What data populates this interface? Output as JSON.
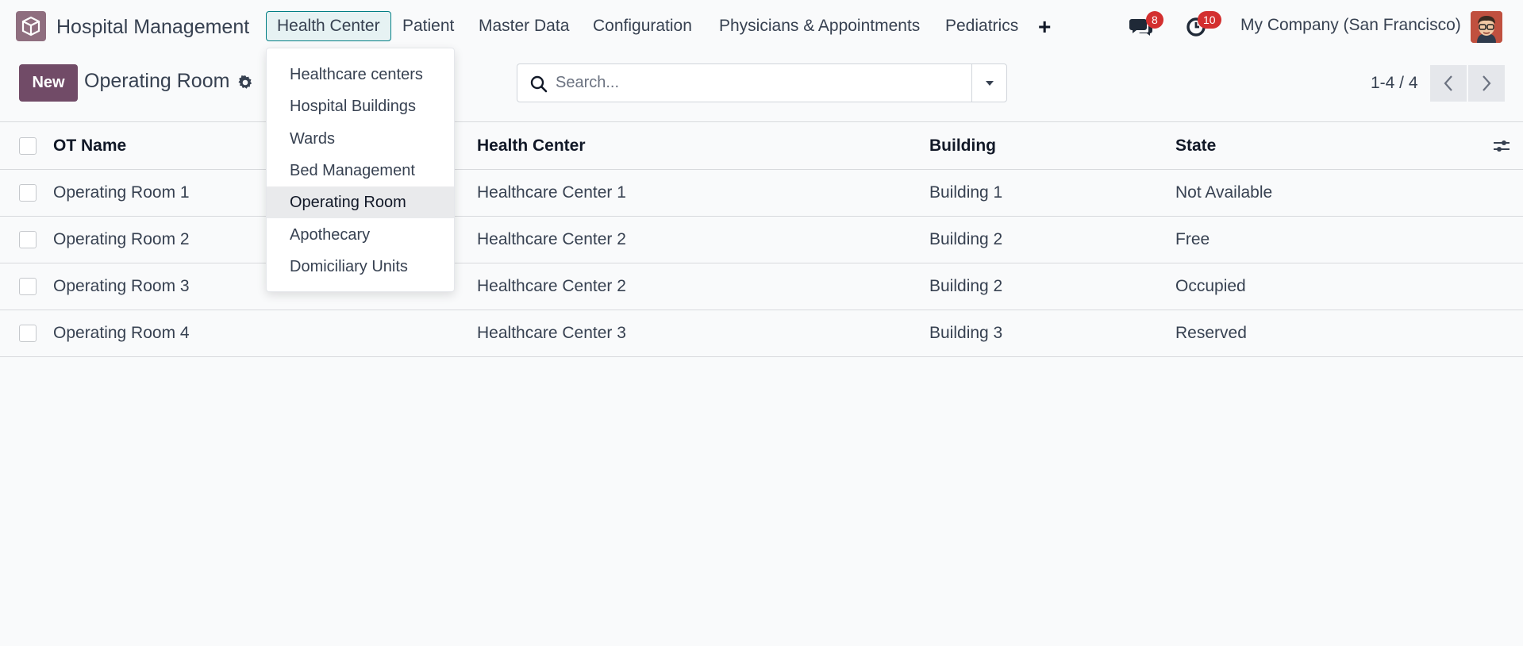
{
  "app": {
    "name": "Hospital Management"
  },
  "menu": {
    "items": [
      {
        "label": "Health Center"
      },
      {
        "label": "Patient"
      },
      {
        "label": "Master Data"
      },
      {
        "label": "Configuration"
      },
      {
        "label": "Physicians & Appointments"
      },
      {
        "label": "Pediatrics"
      }
    ]
  },
  "systray": {
    "messages_count": "8",
    "activities_count": "10",
    "company": "My Company (San Francisco)"
  },
  "control": {
    "new_label": "New",
    "title": "Operating Room",
    "search_placeholder": "Search...",
    "pager": "1-4 / 4"
  },
  "dropdown": {
    "items": [
      {
        "label": "Healthcare centers"
      },
      {
        "label": "Hospital Buildings"
      },
      {
        "label": "Wards"
      },
      {
        "label": "Bed Management"
      },
      {
        "label": "Operating Room"
      },
      {
        "label": "Apothecary"
      },
      {
        "label": "Domiciliary Units"
      }
    ]
  },
  "table": {
    "columns": [
      "OT Name",
      "Health Center",
      "Building",
      "State"
    ],
    "rows": [
      [
        "Operating Room 1",
        "Healthcare Center 1",
        "Building 1",
        "Not Available"
      ],
      [
        "Operating Room 2",
        "Healthcare Center 2",
        "Building 2",
        "Free"
      ],
      [
        "Operating Room 3",
        "Healthcare Center 2",
        "Building 2",
        "Occupied"
      ],
      [
        "Operating Room 4",
        "Healthcare Center 3",
        "Building 3",
        "Reserved"
      ]
    ]
  },
  "colors": {
    "brand": "#714b67",
    "active_menu_border": "#017e84",
    "badge": "#d32f2f"
  },
  "icons": [
    "app-logo-icon",
    "plus-icon",
    "chat-icon",
    "clock-icon",
    "gear-icon",
    "search-icon",
    "caret-down-icon",
    "chevron-left-icon",
    "chevron-right-icon",
    "column-options-icon"
  ]
}
